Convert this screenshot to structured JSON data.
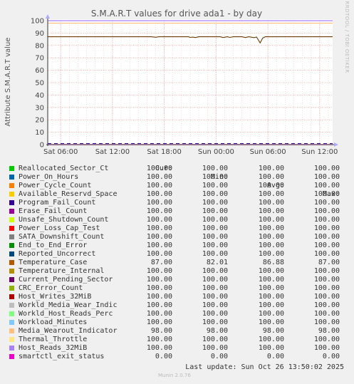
{
  "chart_data": {
    "type": "line",
    "title": "S.M.A.R.T values for drive ada1 - by day",
    "ylabel": "Attribute S.M.A.R.T value",
    "ylim": [
      0,
      100
    ],
    "yticks": [
      0,
      10,
      20,
      30,
      40,
      50,
      60,
      70,
      80,
      90,
      100
    ],
    "xlim_hours": [
      -1.5,
      31.5
    ],
    "xticks": [
      {
        "label": "Sat 06:00",
        "h": 0
      },
      {
        "label": "Sat 12:00",
        "h": 6
      },
      {
        "label": "Sat 18:00",
        "h": 12
      },
      {
        "label": "Sun 00:00",
        "h": 18
      },
      {
        "label": "Sun 06:00",
        "h": 24
      },
      {
        "label": "Sun 12:00",
        "h": 30
      }
    ],
    "watermark": "RRDTOOL / TOBI OETIKER",
    "temperature_trace": [
      [
        -1.5,
        87
      ],
      [
        10.5,
        87
      ],
      [
        11.0,
        86.6
      ],
      [
        11.4,
        87
      ],
      [
        14.8,
        87
      ],
      [
        15.0,
        86.5
      ],
      [
        15.3,
        86.7
      ],
      [
        15.6,
        86.4
      ],
      [
        16.0,
        87
      ],
      [
        18.5,
        87
      ],
      [
        18.8,
        86.4
      ],
      [
        19.3,
        87
      ],
      [
        19.6,
        86.5
      ],
      [
        20.0,
        87
      ],
      [
        21.0,
        87
      ],
      [
        21.4,
        86.4
      ],
      [
        21.8,
        87
      ],
      [
        22.4,
        86.3
      ],
      [
        22.7,
        86.8
      ],
      [
        23.1,
        82.01
      ],
      [
        23.4,
        86
      ],
      [
        23.7,
        87
      ],
      [
        31.5,
        87
      ]
    ],
    "columns": [
      "",
      "Cur:",
      "Min:",
      "Avg:",
      "Max:"
    ],
    "series": [
      {
        "name": "Reallocated_Sector_Ct",
        "color": "#00cc00",
        "cur": "100.00",
        "min": "100.00",
        "avg": "100.00",
        "max": "100.00"
      },
      {
        "name": "Power_On_Hours",
        "color": "#0066b3",
        "cur": "100.00",
        "min": "100.00",
        "avg": "100.00",
        "max": "100.00"
      },
      {
        "name": "Power_Cycle_Count",
        "color": "#ff8000",
        "cur": "100.00",
        "min": "100.00",
        "avg": "100.00",
        "max": "100.00"
      },
      {
        "name": "Available_Reservd_Space",
        "color": "#ffcc00",
        "cur": "100.00",
        "min": "100.00",
        "avg": "100.00",
        "max": "100.00"
      },
      {
        "name": "Program_Fail_Count",
        "color": "#330099",
        "cur": "100.00",
        "min": "100.00",
        "avg": "100.00",
        "max": "100.00"
      },
      {
        "name": "Erase_Fail_Count",
        "color": "#990099",
        "cur": "100.00",
        "min": "100.00",
        "avg": "100.00",
        "max": "100.00"
      },
      {
        "name": "Unsafe_Shutdown_Count",
        "color": "#ccff00",
        "cur": "100.00",
        "min": "100.00",
        "avg": "100.00",
        "max": "100.00"
      },
      {
        "name": "Power_Loss_Cap_Test",
        "color": "#ff0000",
        "cur": "100.00",
        "min": "100.00",
        "avg": "100.00",
        "max": "100.00"
      },
      {
        "name": "SATA_Downshift_Count",
        "color": "#808080",
        "cur": "100.00",
        "min": "100.00",
        "avg": "100.00",
        "max": "100.00"
      },
      {
        "name": "End_to_End_Error",
        "color": "#008f00",
        "cur": "100.00",
        "min": "100.00",
        "avg": "100.00",
        "max": "100.00"
      },
      {
        "name": "Reported_Uncorrect",
        "color": "#00487d",
        "cur": "100.00",
        "min": "100.00",
        "avg": "100.00",
        "max": "100.00"
      },
      {
        "name": "Temperature_Case",
        "color": "#b35a00",
        "cur": "87.00",
        "min": "82.01",
        "avg": "86.88",
        "max": "87.00"
      },
      {
        "name": "Temperature_Internal",
        "color": "#b38f00",
        "cur": "100.00",
        "min": "100.00",
        "avg": "100.00",
        "max": "100.00"
      },
      {
        "name": "Current_Pending_Sector",
        "color": "#6b006b",
        "cur": "100.00",
        "min": "100.00",
        "avg": "100.00",
        "max": "100.00"
      },
      {
        "name": "CRC_Error_Count",
        "color": "#8fb300",
        "cur": "100.00",
        "min": "100.00",
        "avg": "100.00",
        "max": "100.00"
      },
      {
        "name": "Host_Writes_32MiB",
        "color": "#b30000",
        "cur": "100.00",
        "min": "100.00",
        "avg": "100.00",
        "max": "100.00"
      },
      {
        "name": "Workld_Media_Wear_Indic",
        "color": "#bebebe",
        "cur": "100.00",
        "min": "100.00",
        "avg": "100.00",
        "max": "100.00"
      },
      {
        "name": "Workld_Host_Reads_Perc",
        "color": "#80ff80",
        "cur": "100.00",
        "min": "100.00",
        "avg": "100.00",
        "max": "100.00"
      },
      {
        "name": "Workload_Minutes",
        "color": "#80c9ff",
        "cur": "100.00",
        "min": "100.00",
        "avg": "100.00",
        "max": "100.00"
      },
      {
        "name": "Media_Wearout_Indicator",
        "color": "#ffc080",
        "cur": "98.00",
        "min": "98.00",
        "avg": "98.00",
        "max": "98.00"
      },
      {
        "name": "Thermal_Throttle",
        "color": "#ffe680",
        "cur": "100.00",
        "min": "100.00",
        "avg": "100.00",
        "max": "100.00"
      },
      {
        "name": "Host_Reads_32MiB",
        "color": "#aa80ff",
        "cur": "100.00",
        "min": "100.00",
        "avg": "100.00",
        "max": "100.00"
      },
      {
        "name": "smartctl_exit_status",
        "color": "#ee00cc",
        "cur": "0.00",
        "min": "0.00",
        "avg": "0.00",
        "max": "0.00"
      }
    ],
    "flat_lines": [
      {
        "value": 100,
        "color": "#aa80ff"
      },
      {
        "value": 98,
        "color": "#ffc080"
      },
      {
        "value": 0,
        "color": "#ee00cc"
      }
    ]
  },
  "last_update": "Last update:  Sun Oct 26 13:50:02 2025",
  "footer": "Munin 2.0.76"
}
